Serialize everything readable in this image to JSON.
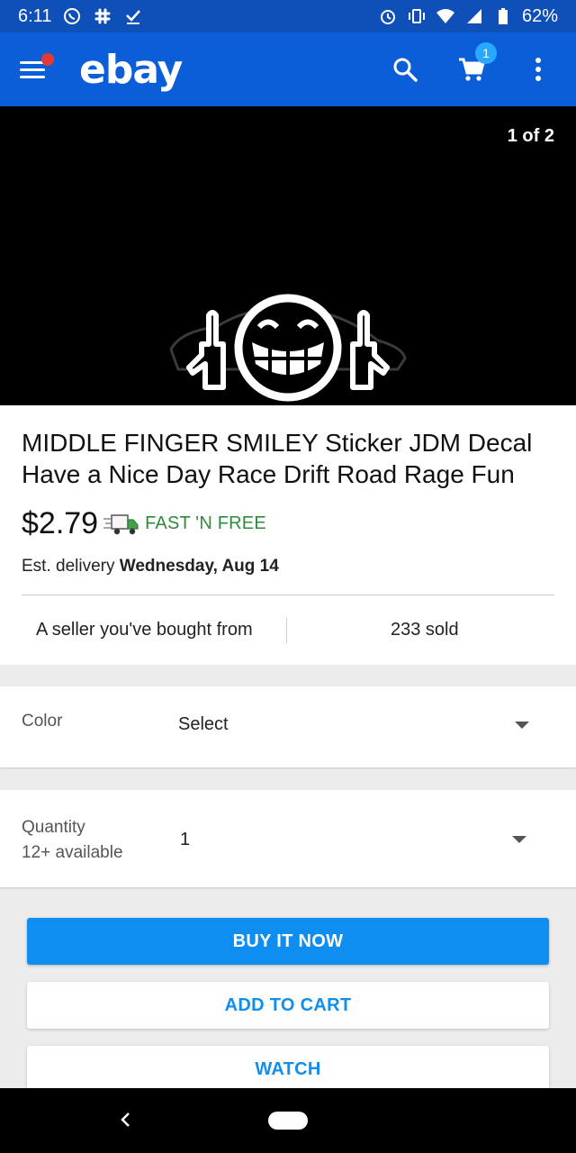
{
  "status_bar": {
    "time": "6:11",
    "battery": "62%",
    "icons_left": [
      "whatsapp-icon",
      "slack-icon",
      "check-icon"
    ],
    "icons_right": [
      "alarm-icon",
      "vibrate-icon",
      "wifi-icon",
      "signal-icon",
      "battery-icon"
    ]
  },
  "app_bar": {
    "logo": "ebay",
    "cart_count": "1",
    "colors": {
      "bar": "#0b5ed7",
      "badge": "#29a8ff",
      "notification_dot": "#e53935"
    }
  },
  "gallery": {
    "pager": "1 of 2"
  },
  "product": {
    "title": "MIDDLE FINGER SMILEY Sticker JDM Decal Have a Nice Day Race Drift Road Rage Fun",
    "price": "$2.79",
    "shipping": "FAST 'N FREE",
    "delivery_prefix": "Est. delivery ",
    "delivery_date": "Wednesday, Aug 14",
    "seller_note": "A seller you've bought from",
    "sold": "233 sold"
  },
  "options": {
    "color_label": "Color",
    "color_value": "Select",
    "quantity_label": "Quantity",
    "quantity_available": "12+ available",
    "quantity_value": "1"
  },
  "actions": {
    "buy_now": "BUY IT NOW",
    "add_to_cart": "ADD TO CART",
    "watch": "WATCH",
    "colors": {
      "primary": "#0f8ef2",
      "shipping_green": "#2e8b3c"
    }
  }
}
